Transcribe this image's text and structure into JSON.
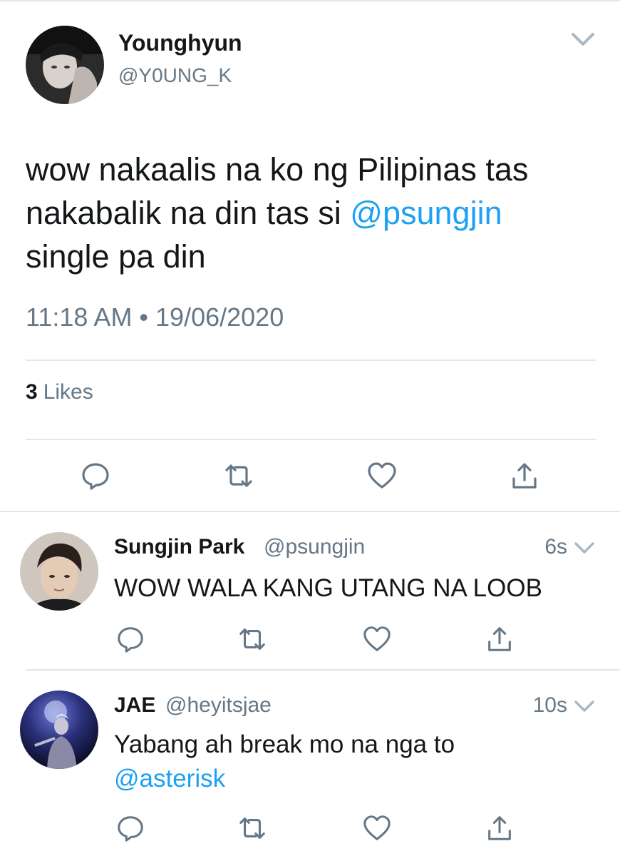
{
  "colors": {
    "text": "#14171a",
    "secondary": "#657786",
    "link": "#1da1f2",
    "divider": "#e1e8ed",
    "icon": "#657786"
  },
  "main_tweet": {
    "author_name": "Younghyun",
    "author_handle": "@Y0UNG_K",
    "text_line1": "wow nakaalis na ko ng Pilipinas tas",
    "text_line2_prefix": "nakabalik na din tas si ",
    "text_mention": "@psungjin",
    "text_line3": "single pa din",
    "timestamp": "11:18 AM • 19/06/2020",
    "likes_count": "3",
    "likes_label": "Likes",
    "icons": [
      "reply-icon",
      "retweet-icon",
      "like-icon",
      "share-icon",
      "chevron-down-icon"
    ]
  },
  "replies": [
    {
      "author_name": "Sungjin Park",
      "author_handle": "@psungjin",
      "time": "6s",
      "text": "WOW WALA KANG UTANG NA LOOB"
    },
    {
      "author_name": "JAE",
      "author_handle": "@heyitsjae",
      "time": "10s",
      "text_line1": "Yabang ah break mo na nga to",
      "text_mention": "@asterisk"
    }
  ]
}
